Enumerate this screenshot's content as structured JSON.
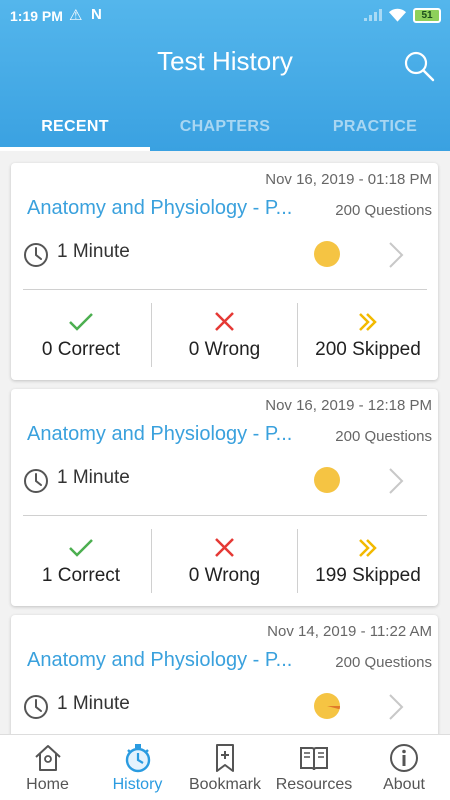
{
  "status": {
    "time": "1:19 PM",
    "warning_icon": "⚠",
    "n_icon": "N",
    "battery": "51"
  },
  "header": {
    "title": "Test History"
  },
  "tabs": [
    {
      "label": "RECENT",
      "active": true
    },
    {
      "label": "CHAPTERS",
      "active": false
    },
    {
      "label": "PRACTICE",
      "active": false
    }
  ],
  "cards": [
    {
      "date": "Nov 16, 2019 - 01:18 PM",
      "title": "Anatomy and Physiology - P...",
      "questions": "200 Questions",
      "duration": "1 Minute",
      "correct": "0 Correct",
      "wrong": "0 Wrong",
      "skipped": "200 Skipped"
    },
    {
      "date": "Nov 16, 2019 - 12:18 PM",
      "title": "Anatomy and Physiology - P...",
      "questions": "200 Questions",
      "duration": "1 Minute",
      "correct": "1 Correct",
      "wrong": "0 Wrong",
      "skipped": "199 Skipped"
    },
    {
      "date": "Nov 14, 2019 - 11:22 AM",
      "title": "Anatomy and Physiology - P...",
      "questions": "200 Questions",
      "duration": "1 Minute"
    }
  ],
  "nav": [
    {
      "label": "Home",
      "icon": "home-icon",
      "active": false
    },
    {
      "label": "History",
      "icon": "stopwatch-icon",
      "active": true
    },
    {
      "label": "Bookmark",
      "icon": "bookmark-icon",
      "active": false
    },
    {
      "label": "Resources",
      "icon": "book-icon",
      "active": false
    },
    {
      "label": "About",
      "icon": "info-icon",
      "active": false
    }
  ],
  "colors": {
    "primary": "#3aa1e1",
    "correct": "#4caf50",
    "wrong": "#e53935",
    "skipped": "#f2b900",
    "progress": "#f5c443"
  }
}
